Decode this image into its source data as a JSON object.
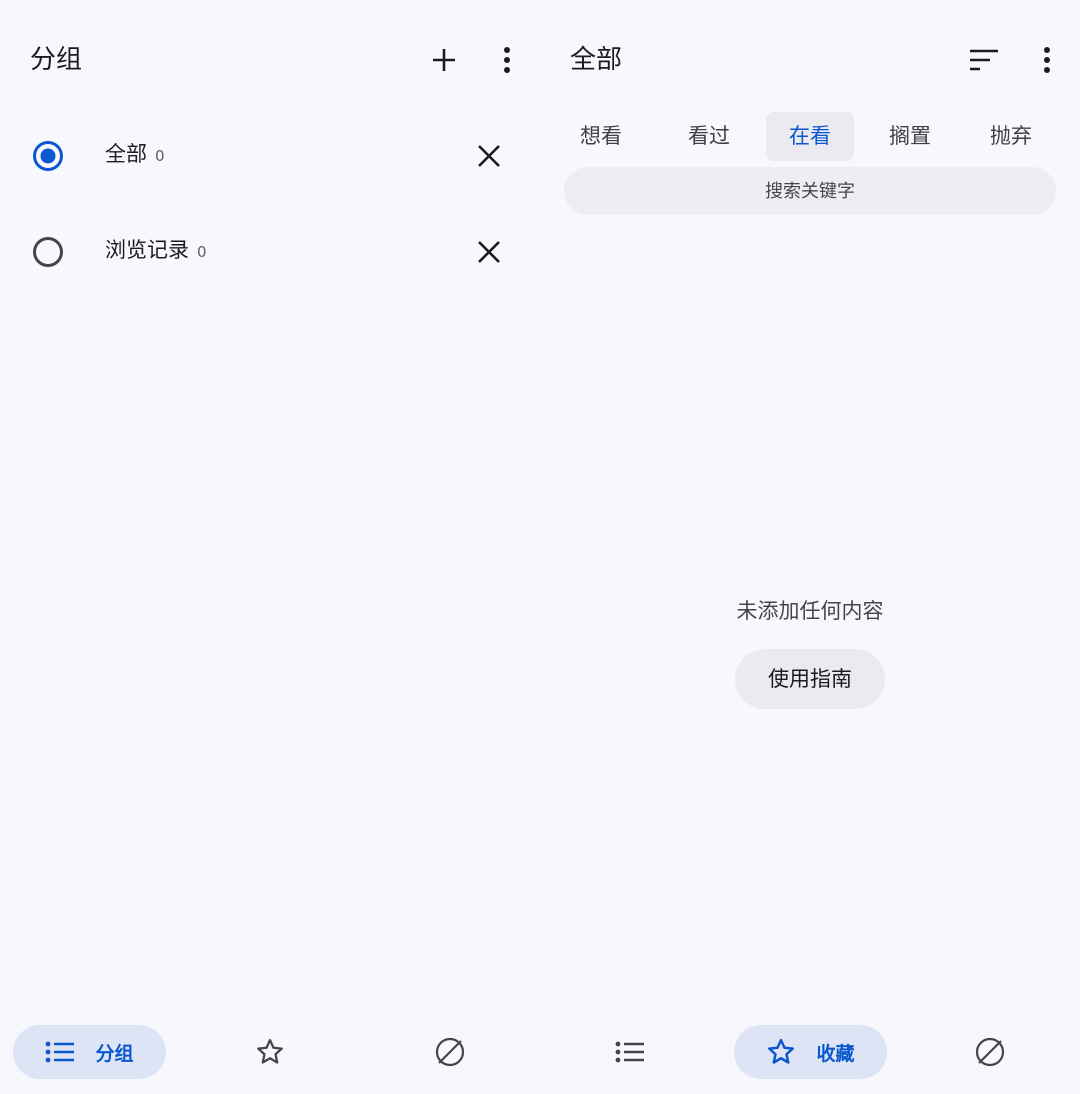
{
  "left_pane": {
    "title": "分组",
    "groups": [
      {
        "label": "全部",
        "count": "0",
        "selected": true
      },
      {
        "label": "浏览记录",
        "count": "0",
        "selected": false
      }
    ],
    "nav": [
      {
        "icon": "list-icon",
        "label": "分组",
        "active": true
      },
      {
        "icon": "star-icon",
        "label": "",
        "active": false
      },
      {
        "icon": "planet-icon",
        "label": "",
        "active": false
      }
    ]
  },
  "right_pane": {
    "title": "全部",
    "tabs": [
      {
        "label": "想看",
        "active": false
      },
      {
        "label": "看过",
        "active": false
      },
      {
        "label": "在看",
        "active": true
      },
      {
        "label": "搁置",
        "active": false
      },
      {
        "label": "抛弃",
        "active": false
      }
    ],
    "search": {
      "placeholder": "搜索关键字",
      "value": ""
    },
    "empty_message": "未添加任何内容",
    "guide_button": "使用指南",
    "nav": [
      {
        "icon": "list-icon",
        "label": "",
        "active": false
      },
      {
        "icon": "star-icon",
        "label": "收藏",
        "active": true
      },
      {
        "icon": "planet-icon",
        "label": "",
        "active": false
      }
    ]
  },
  "colors": {
    "accent": "#0b57d0",
    "background": "#f8f7fd",
    "active_pill": "#dde4f5",
    "surface_variant": "#ebeaf0"
  }
}
